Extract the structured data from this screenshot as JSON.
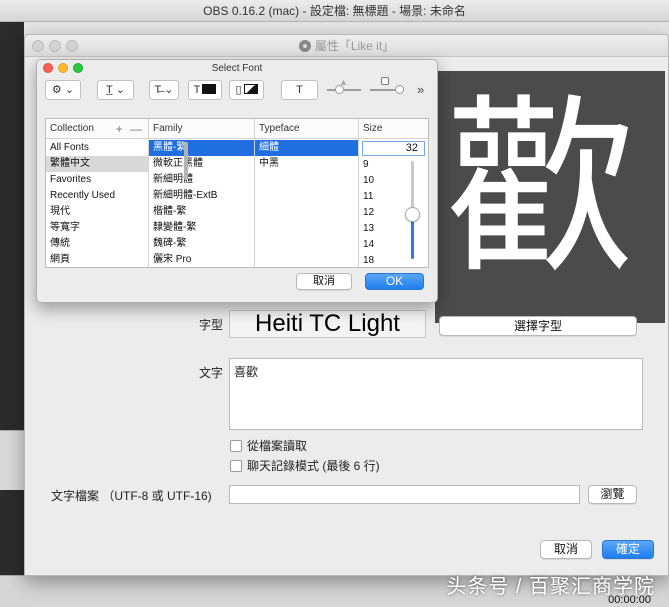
{
  "app": {
    "window_title": "OBS 0.16.2 (mac) - 設定檔: 無標題 - 場景: 未命名",
    "time": "00:00:00",
    "watermark": "头条号 / 百聚汇商学院"
  },
  "properties": {
    "title": "屬性「Like it」",
    "preview_char": "歡",
    "font_label": "字型",
    "font_value": "Heiti TC Light",
    "select_font_button": "選擇字型",
    "text_label": "文字",
    "text_value": "喜歡",
    "checkbox_from_file": "從檔案讀取",
    "checkbox_chatlog": "聊天記錄模式 (最後 6 行)",
    "file_label": "文字檔案 （UTF-8 或 UTF-16)",
    "browse_button": "瀏覽",
    "cancel_button": "取消",
    "ok_button": "確定"
  },
  "select_font": {
    "title": "Select Font",
    "toolbar": {
      "action_icon": "gear-icon",
      "underline_glyph": "T̲",
      "strike_glyph": "T̶",
      "text_color_glyph": "T",
      "doc_color_glyph": "▯",
      "shadow_glyph": "T",
      "more": "»"
    },
    "headers": {
      "collection": "Collection",
      "collection_controls": "+ —",
      "family": "Family",
      "typeface": "Typeface",
      "size": "Size"
    },
    "collections": [
      "All Fonts",
      "繁體中文",
      "Favorites",
      "Recently Used",
      "現代",
      "等寬字",
      "傳統",
      "網頁"
    ],
    "selected_collection": 1,
    "families": [
      "黑體-繁",
      "微軟正黑體",
      "新細明體",
      "新細明體-ExtB",
      "楷體-繁",
      "隸變體-繁",
      "魏碑-繁",
      "儷宋 Pro"
    ],
    "selected_family": 0,
    "typefaces": [
      "細體",
      "中黑"
    ],
    "selected_typeface": 0,
    "size_value": "32",
    "sizes": [
      "9",
      "10",
      "11",
      "12",
      "13",
      "14",
      "18"
    ],
    "size_slider_fraction": 0.45,
    "cancel_button": "取消",
    "ok_button": "OK"
  },
  "colors": {
    "accent": "#1f7ef0",
    "selection_blue": "#1f6fe0",
    "preview_bg": "#4b4b4b"
  }
}
